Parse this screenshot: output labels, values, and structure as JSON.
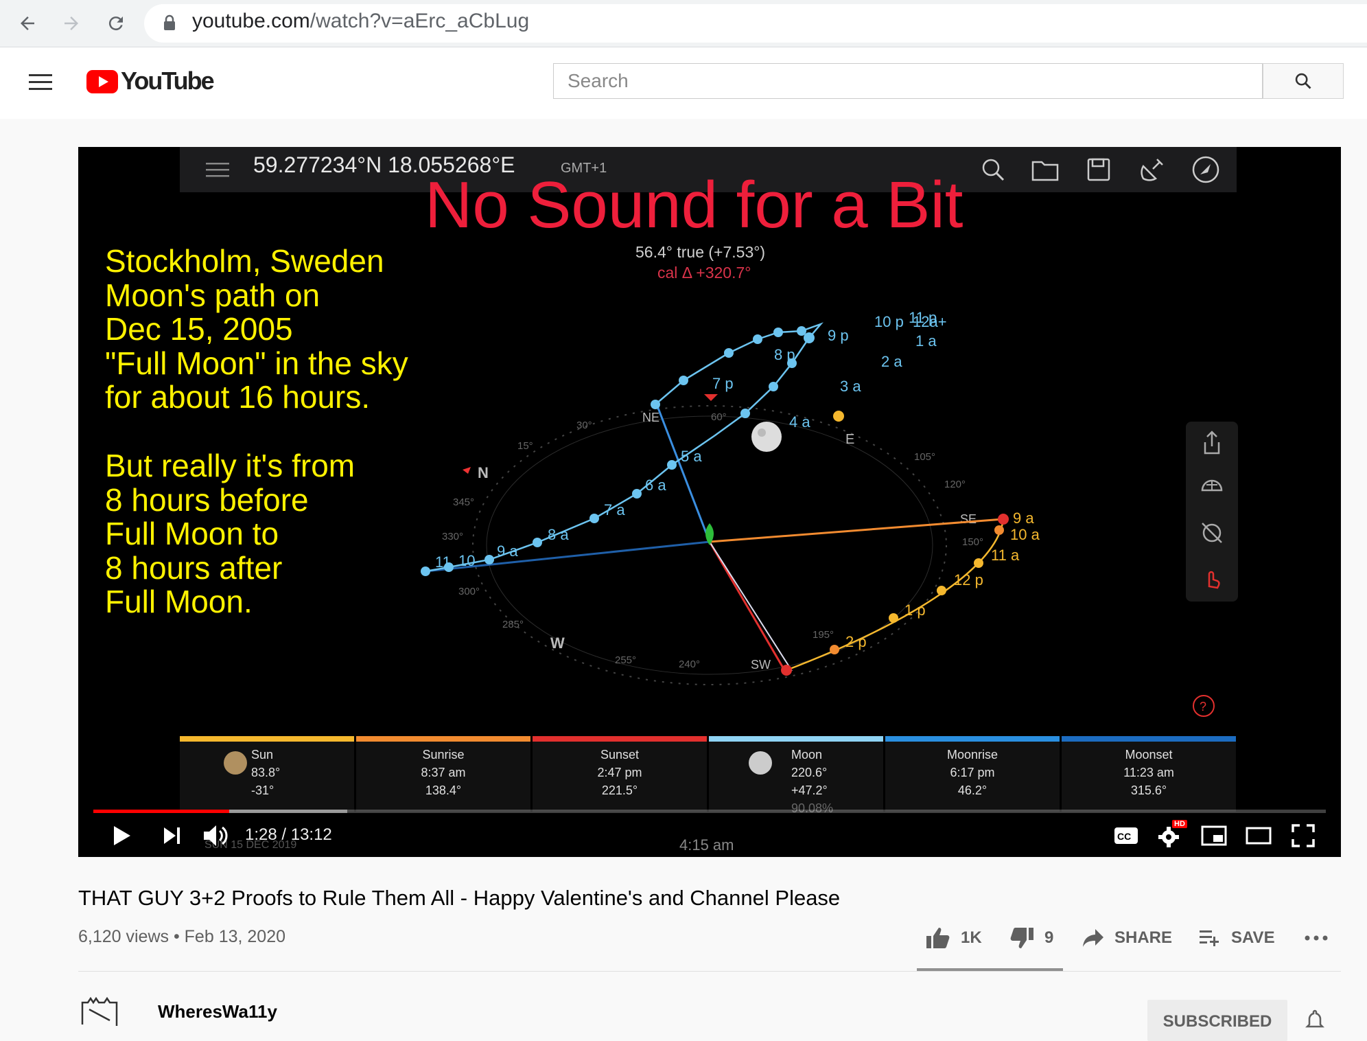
{
  "browser": {
    "url_host": "youtube.com",
    "url_path": "/watch?v=aErc_aCbLug"
  },
  "header": {
    "logo_text": "YouTube",
    "search_placeholder": "Search"
  },
  "video_frame": {
    "coordinates": "59.277234°N 18.055268°E",
    "timezone": "GMT+1",
    "overlay_title": "No Sound for a Bit",
    "bearing": "56.4° true (+7.53°)",
    "calibration": "cal Δ +320.7°",
    "caption_lines_1": [
      "Stockholm, Sweden",
      "Moon's path on",
      "Dec 15, 2005",
      "\"Full Moon\" in the sky",
      "for about 16 hours."
    ],
    "caption_lines_2": [
      "But really it's from",
      "8 hours before",
      "Full Moon to",
      "8 hours after",
      "Full Moon."
    ],
    "compass_labels": {
      "N": "N",
      "NE": "NE",
      "E": "E",
      "SE": "SE",
      "SW": "SW",
      "W": "W",
      "d15": "15°",
      "d30": "30°",
      "d60": "60°",
      "d105": "105°",
      "d120": "120°",
      "d150": "150°",
      "d195": "195°",
      "d240": "240°",
      "d255": "255°",
      "d285": "285°",
      "d300": "300°",
      "d330": "330°",
      "d345": "345°"
    },
    "moon_path_labels": [
      "11",
      "10",
      "9 a",
      "8 a",
      "7 a",
      "6 a",
      "5 a",
      "4 a",
      "3 a",
      "2 a",
      "1 a",
      "12a+",
      "10 p",
      "11 p",
      "9 p",
      "8 p",
      "7 p"
    ],
    "sun_path_labels": [
      "9 a",
      "10 a",
      "11 a",
      "12 p",
      "1 p",
      "2 p"
    ],
    "info_bar": [
      {
        "label": "Sun",
        "line1": "83.8°",
        "line2": "-31°",
        "color": "#f5b82e"
      },
      {
        "label": "Sunrise",
        "line1": "8:37 am",
        "line2": "138.4°",
        "color": "#f28b30"
      },
      {
        "label": "Sunset",
        "line1": "2:47 pm",
        "line2": "221.5°",
        "color": "#e2302e"
      },
      {
        "label": "Moon",
        "line1": "220.6°",
        "line2": "+47.2°",
        "line3": "90.08%",
        "color": "#8fd3f4"
      },
      {
        "label": "Moonrise",
        "line1": "6:17 pm",
        "line2": "46.2°",
        "color": "#2a8fe0"
      },
      {
        "label": "Moonset",
        "line1": "11:23 am",
        "line2": "315.6°",
        "color": "#1c6cc0"
      }
    ],
    "date_under": "SUN 15 DEC 2019",
    "time_under": "4:15 am"
  },
  "player": {
    "time_display": "1:28 / 13:12",
    "progress_played": 0.11,
    "progress_buffered": 0.206,
    "hd_badge": "HD"
  },
  "video": {
    "title": "THAT GUY 3+2 Proofs to Rule Them All - Happy Valentine's and Channel Please",
    "meta": "6,120 views • Feb 13, 2020",
    "likes": "1K",
    "dislikes": "9",
    "share_label": "SHARE",
    "save_label": "SAVE"
  },
  "channel": {
    "name": "WheresWa11y",
    "subscribe_label": "SUBSCRIBED"
  },
  "colors": {
    "youtube_red": "#ff0000",
    "overlay_red": "#ee1f3b",
    "caption_yellow": "#fff200"
  }
}
